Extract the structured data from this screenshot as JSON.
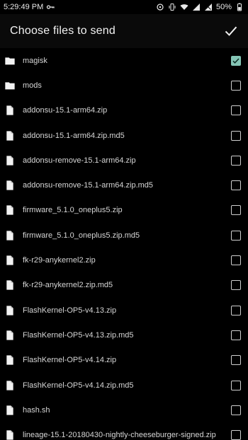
{
  "status_bar": {
    "time": "5:29:49 PM",
    "battery": "50%",
    "icons": [
      "key-icon",
      "sync-icon",
      "vibrate-icon",
      "wifi-icon",
      "lte-signal-icon",
      "signal-icon",
      "battery-icon"
    ]
  },
  "toolbar": {
    "title": "Choose files to send",
    "confirm_icon": "checkmark-icon"
  },
  "colors": {
    "background": "#000000",
    "checked": "#85c5b5"
  },
  "files": [
    {
      "name": "magisk",
      "type": "folder",
      "checked": true
    },
    {
      "name": "mods",
      "type": "folder",
      "checked": false
    },
    {
      "name": "addonsu-15.1-arm64.zip",
      "type": "file",
      "checked": false
    },
    {
      "name": "addonsu-15.1-arm64.zip.md5",
      "type": "file",
      "checked": false
    },
    {
      "name": "addonsu-remove-15.1-arm64.zip",
      "type": "file",
      "checked": false
    },
    {
      "name": "addonsu-remove-15.1-arm64.zip.md5",
      "type": "file",
      "checked": false
    },
    {
      "name": "firmware_5.1.0_oneplus5.zip",
      "type": "file",
      "checked": false
    },
    {
      "name": "firmware_5.1.0_oneplus5.zip.md5",
      "type": "file",
      "checked": false
    },
    {
      "name": "fk-r29-anykernel2.zip",
      "type": "file",
      "checked": false
    },
    {
      "name": "fk-r29-anykernel2.zip.md5",
      "type": "file",
      "checked": false
    },
    {
      "name": "FlashKernel-OP5-v4.13.zip",
      "type": "file",
      "checked": false
    },
    {
      "name": "FlashKernel-OP5-v4.13.zip.md5",
      "type": "file",
      "checked": false
    },
    {
      "name": "FlashKernel-OP5-v4.14.zip",
      "type": "file",
      "checked": false
    },
    {
      "name": "FlashKernel-OP5-v4.14.zip.md5",
      "type": "file",
      "checked": false
    },
    {
      "name": "hash.sh",
      "type": "file",
      "checked": false
    },
    {
      "name": "lineage-15.1-20180430-nightly-cheeseburger-signed.zip",
      "type": "file",
      "checked": false
    }
  ]
}
